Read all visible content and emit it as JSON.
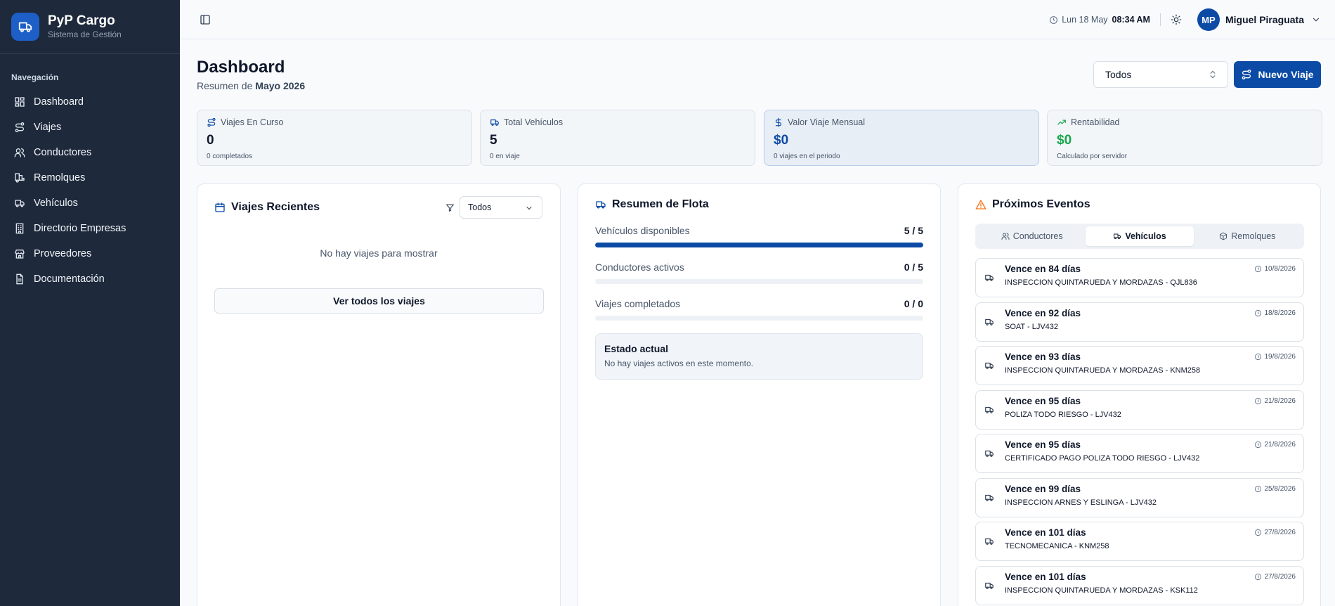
{
  "brand": {
    "title": "PyP Cargo",
    "subtitle": "Sistema de Gestión"
  },
  "nav": {
    "label": "Navegación",
    "items": [
      {
        "label": "Dashboard",
        "icon": "grid-icon"
      },
      {
        "label": "Viajes",
        "icon": "route-icon"
      },
      {
        "label": "Conductores",
        "icon": "users-icon"
      },
      {
        "label": "Remolques",
        "icon": "trailer-icon"
      },
      {
        "label": "Vehículos",
        "icon": "truck-icon"
      },
      {
        "label": "Directorio Empresas",
        "icon": "building-icon"
      },
      {
        "label": "Proveedores",
        "icon": "store-icon"
      },
      {
        "label": "Documentación",
        "icon": "document-icon"
      }
    ]
  },
  "topbar": {
    "date": "Lun 18 May",
    "time": "08:34 AM",
    "user_initials": "MP",
    "user_name": "Miguel Piraguata"
  },
  "header": {
    "title": "Dashboard",
    "subtitle_prefix": "Resumen de",
    "subtitle_period": "Mayo 2026",
    "filter_value": "Todos",
    "new_trip_label": "Nuevo Viaje"
  },
  "stats": [
    {
      "label": "Viajes En Curso",
      "value": "0",
      "sub": "0 completados",
      "color": "#0f172a"
    },
    {
      "label": "Total Vehículos",
      "value": "5",
      "sub": "0 en viaje",
      "color": "#0f172a"
    },
    {
      "label": "Valor Viaje Mensual",
      "value": "$0",
      "sub": "0 viajes en el periodo",
      "color": "#0b4aa5"
    },
    {
      "label": "Rentabilidad",
      "value": "$0",
      "sub": "Calculado por servidor",
      "color": "#16a34a"
    }
  ],
  "recent": {
    "title": "Viajes Recientes",
    "filter_value": "Todos",
    "empty": "No hay viajes para mostrar",
    "view_all": "Ver todos los viajes"
  },
  "fleet": {
    "title": "Resumen de Flota",
    "meters": [
      {
        "label": "Vehículos disponibles",
        "value": "5 / 5",
        "fraction": 1.0
      },
      {
        "label": "Conductores activos",
        "value": "0 / 5",
        "fraction": 0.0
      },
      {
        "label": "Viajes completados",
        "value": "0 / 0",
        "fraction": 0.0
      }
    ],
    "status_title": "Estado actual",
    "status_text": "No hay viajes activos en este momento."
  },
  "events": {
    "title": "Próximos Eventos",
    "tabs": [
      {
        "label": "Conductores",
        "icon": "users-icon",
        "active": false
      },
      {
        "label": "Vehículos",
        "icon": "truck-icon",
        "active": true
      },
      {
        "label": "Remolques",
        "icon": "trailer-icon",
        "active": false
      }
    ],
    "items": [
      {
        "title": "Vence en 84 días",
        "desc": "INSPECCION QUINTARUEDA Y MORDAZAS - QJL836",
        "date": "10/8/2026"
      },
      {
        "title": "Vence en 92 días",
        "desc": "SOAT - LJV432",
        "date": "18/8/2026"
      },
      {
        "title": "Vence en 93 días",
        "desc": "INSPECCION QUINTARUEDA Y MORDAZAS - KNM258",
        "date": "19/8/2026"
      },
      {
        "title": "Vence en 95 días",
        "desc": "POLIZA TODO RIESGO - LJV432",
        "date": "21/8/2026"
      },
      {
        "title": "Vence en 95 días",
        "desc": "CERTIFICADO PAGO POLIZA TODO RIESGO - LJV432",
        "date": "21/8/2026"
      },
      {
        "title": "Vence en 99 días",
        "desc": "INSPECCION ARNES Y ESLINGA - LJV432",
        "date": "25/8/2026"
      },
      {
        "title": "Vence en 101 días",
        "desc": "TECNOMECANICA - KNM258",
        "date": "27/8/2026"
      },
      {
        "title": "Vence en 101 días",
        "desc": "INSPECCION QUINTARUEDA Y MORDAZAS - KSK112",
        "date": "27/8/2026"
      }
    ]
  },
  "colors": {
    "primary": "#0b4aa5",
    "sidebar": "#1e293b",
    "success": "#16a34a",
    "warning": "#f97316"
  }
}
